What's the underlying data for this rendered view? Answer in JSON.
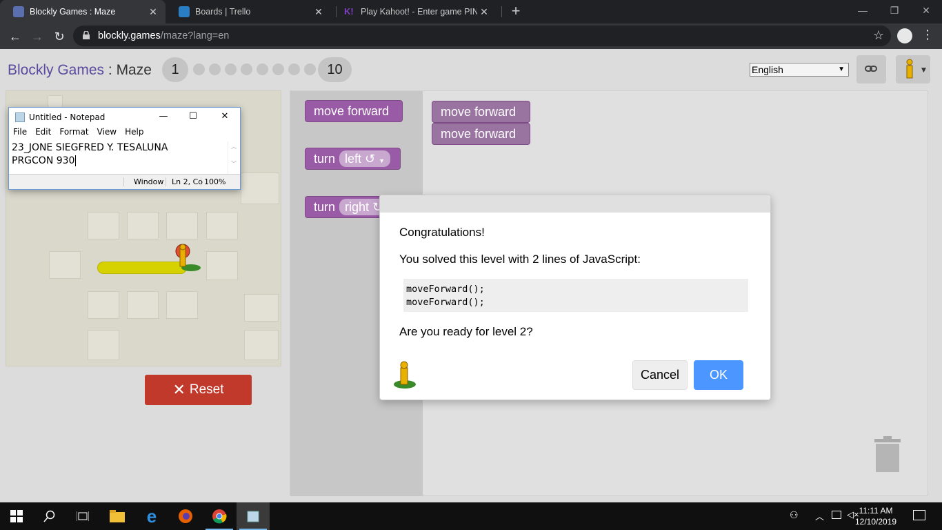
{
  "browser": {
    "tabs": [
      {
        "title": "Blockly Games : Maze",
        "active": true
      },
      {
        "title": "Boards | Trello",
        "active": false
      },
      {
        "title": "Play Kahoot! - Enter game PIN he",
        "active": false
      }
    ],
    "url_host": "blockly.games",
    "url_path": "/maze?lang=en"
  },
  "header": {
    "brand": "Blockly Games",
    "separator": " : ",
    "game": "Maze",
    "level_first": "1",
    "level_last": "10",
    "current_level": 1,
    "language": "English"
  },
  "maze": {
    "reset_label": "Reset"
  },
  "workspace": {
    "toolbox": [
      {
        "label": "move forward"
      },
      {
        "label": "turn",
        "option": "left ↺"
      },
      {
        "label": "turn",
        "option": "right ↻"
      }
    ],
    "program": [
      "move forward",
      "move forward"
    ]
  },
  "notepad": {
    "title": "Untitled - Notepad",
    "menu": [
      "File",
      "Edit",
      "Format",
      "View",
      "Help"
    ],
    "lines": [
      "23_JONE SIEGFRED Y. TESALUNA",
      "PRGCON 930"
    ],
    "status_window": "Window",
    "status_pos": "Ln 2, Co",
    "status_zoom": "100%"
  },
  "dialog": {
    "congrats": "Congratulations!",
    "solved": "You solved this level with 2 lines of JavaScript:",
    "code": [
      "moveForward();",
      "moveForward();"
    ],
    "ready": "Are you ready for level 2?",
    "cancel": "Cancel",
    "ok": "OK"
  },
  "taskbar": {
    "time": "11:11 AM",
    "date": "12/10/2019"
  },
  "colors": {
    "block": "#995ba5",
    "reset": "#c0392b",
    "ok": "#4c97ff"
  }
}
